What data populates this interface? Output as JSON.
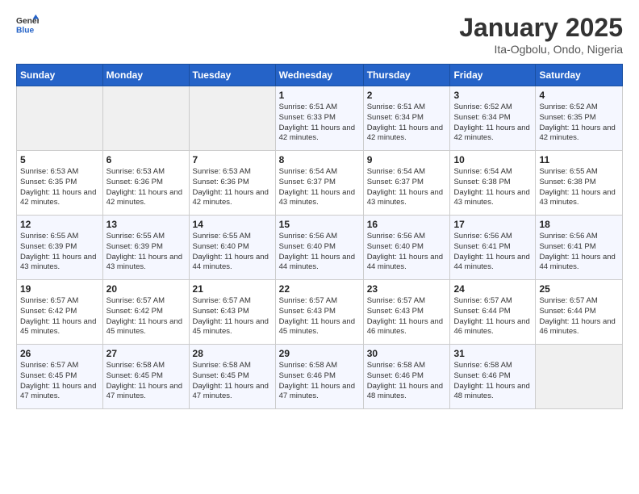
{
  "header": {
    "logo_general": "General",
    "logo_blue": "Blue",
    "title": "January 2025",
    "subtitle": "Ita-Ogbolu, Ondo, Nigeria"
  },
  "weekdays": [
    "Sunday",
    "Monday",
    "Tuesday",
    "Wednesday",
    "Thursday",
    "Friday",
    "Saturday"
  ],
  "weeks": [
    [
      {
        "day": "",
        "empty": true
      },
      {
        "day": "",
        "empty": true
      },
      {
        "day": "",
        "empty": true
      },
      {
        "day": "1",
        "sunrise": "6:51 AM",
        "sunset": "6:33 PM",
        "daylight": "11 hours and 42 minutes."
      },
      {
        "day": "2",
        "sunrise": "6:51 AM",
        "sunset": "6:34 PM",
        "daylight": "11 hours and 42 minutes."
      },
      {
        "day": "3",
        "sunrise": "6:52 AM",
        "sunset": "6:34 PM",
        "daylight": "11 hours and 42 minutes."
      },
      {
        "day": "4",
        "sunrise": "6:52 AM",
        "sunset": "6:35 PM",
        "daylight": "11 hours and 42 minutes."
      }
    ],
    [
      {
        "day": "5",
        "sunrise": "6:53 AM",
        "sunset": "6:35 PM",
        "daylight": "11 hours and 42 minutes."
      },
      {
        "day": "6",
        "sunrise": "6:53 AM",
        "sunset": "6:36 PM",
        "daylight": "11 hours and 42 minutes."
      },
      {
        "day": "7",
        "sunrise": "6:53 AM",
        "sunset": "6:36 PM",
        "daylight": "11 hours and 42 minutes."
      },
      {
        "day": "8",
        "sunrise": "6:54 AM",
        "sunset": "6:37 PM",
        "daylight": "11 hours and 43 minutes."
      },
      {
        "day": "9",
        "sunrise": "6:54 AM",
        "sunset": "6:37 PM",
        "daylight": "11 hours and 43 minutes."
      },
      {
        "day": "10",
        "sunrise": "6:54 AM",
        "sunset": "6:38 PM",
        "daylight": "11 hours and 43 minutes."
      },
      {
        "day": "11",
        "sunrise": "6:55 AM",
        "sunset": "6:38 PM",
        "daylight": "11 hours and 43 minutes."
      }
    ],
    [
      {
        "day": "12",
        "sunrise": "6:55 AM",
        "sunset": "6:39 PM",
        "daylight": "11 hours and 43 minutes."
      },
      {
        "day": "13",
        "sunrise": "6:55 AM",
        "sunset": "6:39 PM",
        "daylight": "11 hours and 43 minutes."
      },
      {
        "day": "14",
        "sunrise": "6:55 AM",
        "sunset": "6:40 PM",
        "daylight": "11 hours and 44 minutes."
      },
      {
        "day": "15",
        "sunrise": "6:56 AM",
        "sunset": "6:40 PM",
        "daylight": "11 hours and 44 minutes."
      },
      {
        "day": "16",
        "sunrise": "6:56 AM",
        "sunset": "6:40 PM",
        "daylight": "11 hours and 44 minutes."
      },
      {
        "day": "17",
        "sunrise": "6:56 AM",
        "sunset": "6:41 PM",
        "daylight": "11 hours and 44 minutes."
      },
      {
        "day": "18",
        "sunrise": "6:56 AM",
        "sunset": "6:41 PM",
        "daylight": "11 hours and 44 minutes."
      }
    ],
    [
      {
        "day": "19",
        "sunrise": "6:57 AM",
        "sunset": "6:42 PM",
        "daylight": "11 hours and 45 minutes."
      },
      {
        "day": "20",
        "sunrise": "6:57 AM",
        "sunset": "6:42 PM",
        "daylight": "11 hours and 45 minutes."
      },
      {
        "day": "21",
        "sunrise": "6:57 AM",
        "sunset": "6:43 PM",
        "daylight": "11 hours and 45 minutes."
      },
      {
        "day": "22",
        "sunrise": "6:57 AM",
        "sunset": "6:43 PM",
        "daylight": "11 hours and 45 minutes."
      },
      {
        "day": "23",
        "sunrise": "6:57 AM",
        "sunset": "6:43 PM",
        "daylight": "11 hours and 46 minutes."
      },
      {
        "day": "24",
        "sunrise": "6:57 AM",
        "sunset": "6:44 PM",
        "daylight": "11 hours and 46 minutes."
      },
      {
        "day": "25",
        "sunrise": "6:57 AM",
        "sunset": "6:44 PM",
        "daylight": "11 hours and 46 minutes."
      }
    ],
    [
      {
        "day": "26",
        "sunrise": "6:57 AM",
        "sunset": "6:45 PM",
        "daylight": "11 hours and 47 minutes."
      },
      {
        "day": "27",
        "sunrise": "6:58 AM",
        "sunset": "6:45 PM",
        "daylight": "11 hours and 47 minutes."
      },
      {
        "day": "28",
        "sunrise": "6:58 AM",
        "sunset": "6:45 PM",
        "daylight": "11 hours and 47 minutes."
      },
      {
        "day": "29",
        "sunrise": "6:58 AM",
        "sunset": "6:46 PM",
        "daylight": "11 hours and 47 minutes."
      },
      {
        "day": "30",
        "sunrise": "6:58 AM",
        "sunset": "6:46 PM",
        "daylight": "11 hours and 48 minutes."
      },
      {
        "day": "31",
        "sunrise": "6:58 AM",
        "sunset": "6:46 PM",
        "daylight": "11 hours and 48 minutes."
      },
      {
        "day": "",
        "empty": true
      }
    ]
  ]
}
